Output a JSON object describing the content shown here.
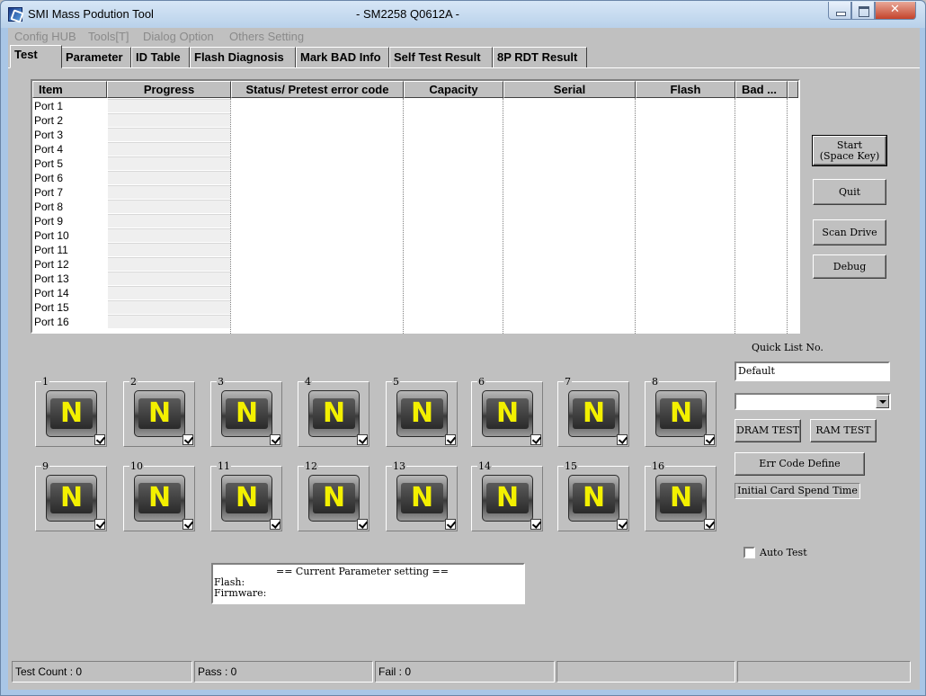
{
  "window": {
    "title": "SMI Mass Podution Tool",
    "subtitle": "- SM2258 Q0612A -"
  },
  "menu": [
    "Config HUB",
    "Tools[T]",
    "Dialog Option",
    "Others Setting"
  ],
  "tabs": [
    "Test",
    "Parameter",
    "ID Table",
    "Flash Diagnosis",
    "Mark BAD Info",
    "Self Test Result",
    "8P RDT Result"
  ],
  "list": {
    "columns": [
      "Item",
      "Progress",
      "Status/ Pretest error code",
      "Capacity",
      "Serial",
      "Flash",
      "Bad ..."
    ],
    "rows": [
      "Port 1",
      "Port 2",
      "Port 3",
      "Port 4",
      "Port 5",
      "Port 6",
      "Port 7",
      "Port 8",
      "Port 9",
      "Port 10",
      "Port 11",
      "Port 12",
      "Port 13",
      "Port 14",
      "Port 15",
      "Port 16"
    ]
  },
  "buttons": {
    "start_line1": "Start",
    "start_line2": "(Space Key)",
    "quit": "Quit",
    "scan_drive": "Scan Drive",
    "debug": "Debug",
    "dram_test": "DRAM TEST",
    "ram_test": "RAM TEST",
    "err_code_define": "Err Code Define"
  },
  "quick_list": {
    "label": "Quick List No.",
    "value": "Default",
    "combo_value": ""
  },
  "initial_card_spend_time": "Initial Card Spend Time",
  "auto_test": {
    "label": "Auto Test",
    "checked": false
  },
  "slots": [
    {
      "num": "1",
      "letter": "N"
    },
    {
      "num": "2",
      "letter": "N"
    },
    {
      "num": "3",
      "letter": "N"
    },
    {
      "num": "4",
      "letter": "N"
    },
    {
      "num": "5",
      "letter": "N"
    },
    {
      "num": "6",
      "letter": "N"
    },
    {
      "num": "7",
      "letter": "N"
    },
    {
      "num": "8",
      "letter": "N"
    },
    {
      "num": "9",
      "letter": "N"
    },
    {
      "num": "10",
      "letter": "N"
    },
    {
      "num": "11",
      "letter": "N"
    },
    {
      "num": "12",
      "letter": "N"
    },
    {
      "num": "13",
      "letter": "N"
    },
    {
      "num": "14",
      "letter": "N"
    },
    {
      "num": "15",
      "letter": "N"
    },
    {
      "num": "16",
      "letter": "N"
    }
  ],
  "params": {
    "heading": "== Current Parameter setting ==",
    "flash": "Flash:",
    "firmware": "Firmware:"
  },
  "status": {
    "test_count": "Test Count : 0",
    "pass": "Pass : 0",
    "fail": "Fail : 0",
    "cell4": "",
    "cell5": ""
  }
}
